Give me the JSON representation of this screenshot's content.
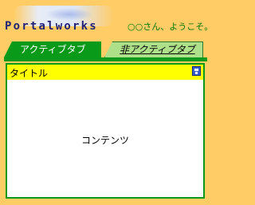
{
  "header": {
    "logo_text": "Portalworks",
    "logo_stamp": "portalworks",
    "welcome": "○○さん、ようこそ。"
  },
  "tabs": [
    {
      "label": "アクティブタブ",
      "active": true
    },
    {
      "label": "非アクティブタブ",
      "active": false
    }
  ],
  "panel": {
    "title": "タイトル",
    "content": "コンテンツ"
  },
  "colors": {
    "background": "#ffcc66",
    "accent_green": "#0a9a1a",
    "inactive_tab": "#aee08a",
    "title_bar": "#ffff00",
    "welcome_text": "#0a7a0a"
  },
  "icons": {
    "panel_icon": "window-icon"
  }
}
